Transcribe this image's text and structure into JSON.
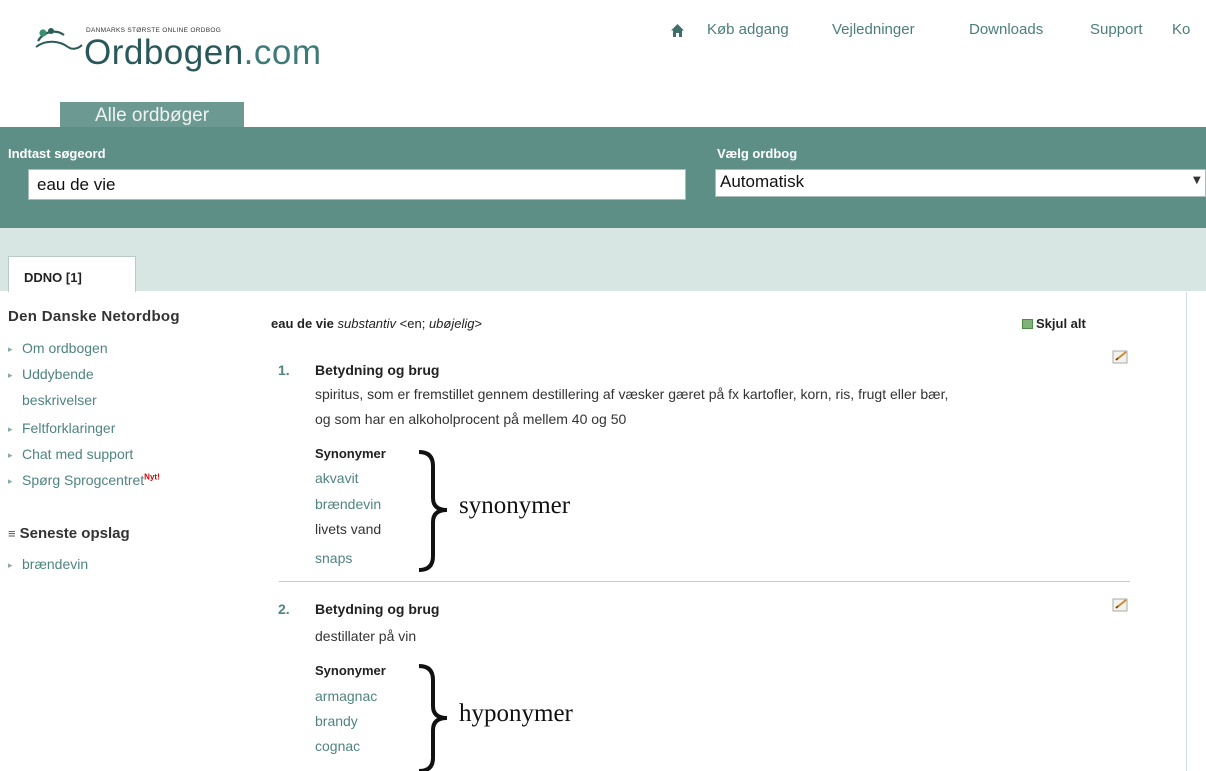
{
  "header": {
    "logo_tagline": "DANMARKS STØRSTE ONLINE ORDBOG",
    "logo_name": "Ordbogen",
    "logo_tld": ".com",
    "nav": [
      "Køb adgang",
      "Vejledninger",
      "Downloads",
      "Support",
      "Ko"
    ],
    "tab": "Alle ordbøger"
  },
  "search": {
    "label": "Indtast søgeord",
    "value": "eau de vie",
    "dict_label": "Vælg ordbog",
    "dict_value": "Automatisk"
  },
  "results_tab": "DDNO [1]",
  "sidebar": {
    "title": "Den Danske Netordbog",
    "items": [
      "Om ordbogen",
      "Uddybende",
      "beskrivelser",
      "Feltforklaringer",
      "Chat med support",
      "Spørg Sprogcentret"
    ],
    "nyt_badge": "Nyt!",
    "recent_title": "Seneste opslag",
    "recent_items": [
      "brændevin"
    ]
  },
  "entry": {
    "headword": "eau de vie",
    "pos": "substantiv",
    "grammar_prefix": "<en; ",
    "grammar_italic": "ubøjelig",
    "grammar_suffix": ">",
    "hide_all": "Skjul alt",
    "senses": [
      {
        "number": "1.",
        "heading": "Betydning og brug",
        "definition_line1": "spiritus, som er fremstillet gennem destillering af væsker gæret på fx kartofler, korn, ris, frugt eller bær,",
        "definition_line2": "og som har en alkoholprocent på mellem 40 og 50",
        "syn_heading": "Synonymer",
        "synonyms": [
          "akvavit",
          "brændevin",
          "livets vand",
          "snaps"
        ]
      },
      {
        "number": "2.",
        "heading": "Betydning og brug",
        "definition_line1": "destillater på vin",
        "syn_heading": "Synonymer",
        "synonyms": [
          "armagnac",
          "brandy",
          "cognac"
        ]
      }
    ]
  },
  "annotations": {
    "label1": "synonymer",
    "label2": "hyponymer"
  },
  "colors": {
    "brand_teal": "#5e8f87",
    "link_teal": "#4f8480",
    "light_band": "#d8e6e3"
  },
  "icons": [
    "logo-bird-icon",
    "home-icon",
    "hide-all-icon",
    "edit-note-icon",
    "dropdown-arrow-icon",
    "list-icon",
    "bullet-arrow-icon"
  ]
}
